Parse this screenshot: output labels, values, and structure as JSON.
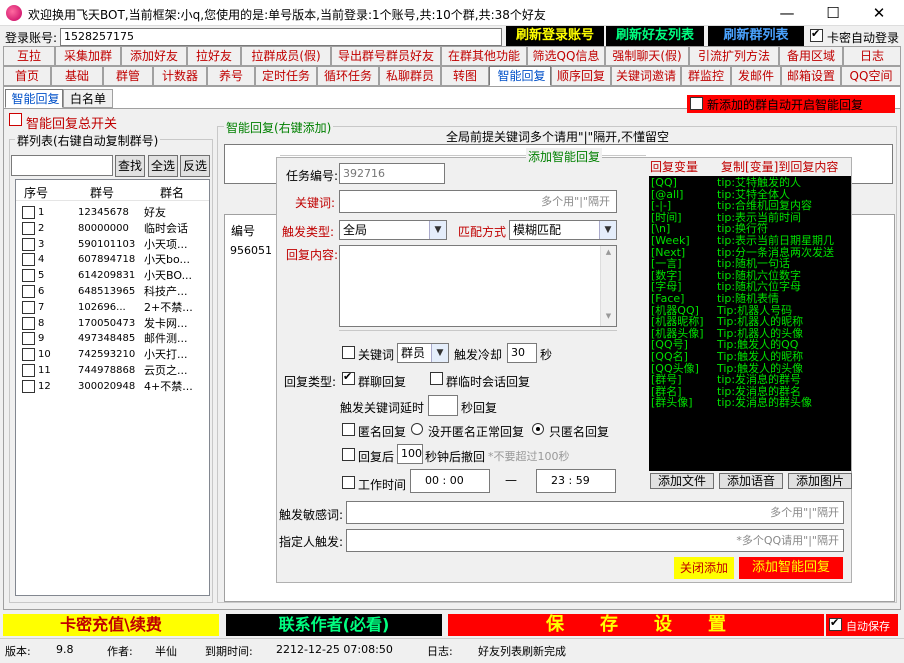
{
  "window": {
    "title": "欢迎换用飞天BOT,当前框架:小q,您使用的是:单号版本,当前登录:1个账号,共:10个群,共:38个好友",
    "minimize": "—",
    "maximize": "☐",
    "close": "✕"
  },
  "topbar": {
    "login_label": "登录账号:",
    "login_value": "1528257175",
    "refresh_login": "刷新登录账号",
    "refresh_friends": "刷新好友列表",
    "refresh_groups": "刷新群列表",
    "auto_login": "卡密自动登录",
    "auto_login_checked": true,
    "colors": {
      "refresh_login": "#ffff00",
      "refresh_friends": "#00ff80",
      "refresh_groups": "#4aa3ff"
    }
  },
  "tabs_row1": [
    "互拉",
    "采集加群",
    "添加好友",
    "拉好友",
    "拉群成员(假)",
    "导出群号群员好友",
    "在群其他功能",
    "筛选QQ信息",
    "强制聊天(假)",
    "引流扩列方法",
    "备用区域",
    "日志"
  ],
  "tabs_row2": [
    "首页",
    "基础",
    "群管",
    "计数器",
    "养号",
    "定时任务",
    "循环任务",
    "私聊群员",
    "转图",
    "智能回复",
    "顺序回复",
    "关键词邀请",
    "群监控",
    "发邮件",
    "邮箱设置",
    "QQ空间"
  ],
  "tabs_row2_selected": "智能回复",
  "subtabs": [
    "智能回复",
    "白名单"
  ],
  "subtab_selected": "智能回复",
  "new_group_auto": "新添加的群自动开启智能回复",
  "left": {
    "master_switch": "智能回复总开关",
    "group_list_title": "群列表(右键自动复制群号)",
    "search_btn": "查找",
    "select_all_btn": "全选",
    "invert_btn": "反选",
    "columns": [
      "序号",
      "群号",
      "群名"
    ],
    "rows": [
      [
        "1",
        "12345678",
        "好友"
      ],
      [
        "2",
        "80000000",
        "临时会话"
      ],
      [
        "3",
        "590101103",
        "小天项..."
      ],
      [
        "4",
        "607894718",
        "小天bo..."
      ],
      [
        "5",
        "614209831",
        "小天BO..."
      ],
      [
        "6",
        "648513965",
        "科技产..."
      ],
      [
        "7",
        "102696...",
        "2+不禁..."
      ],
      [
        "8",
        "170050473",
        "发卡网..."
      ],
      [
        "9",
        "497348485",
        "邮件测..."
      ],
      [
        "10",
        "742593210",
        "小天打..."
      ],
      [
        "11",
        "744978868",
        "云页之..."
      ],
      [
        "12",
        "300020948",
        "4+不禁..."
      ]
    ]
  },
  "right": {
    "section_title": "智能回复(右键添加)",
    "global_hint": "全局前提关键词多个请用\"|\"隔开,不懂留空",
    "col_id": "编号",
    "first_id": "956051"
  },
  "dialog": {
    "title": "添加智能回复",
    "task_label": "任务编号:",
    "task_value": "392716",
    "keyword_label": "关键词:",
    "keyword_placeholder": "多个用\"|\"隔开",
    "trigger_type_label": "触发类型:",
    "trigger_type_value": "全局",
    "match_label": "匹配方式",
    "match_value": "模糊匹配",
    "reply_label": "回复内容:",
    "kw_cb": "关键词",
    "kw_role": "群员",
    "cooldown_label": "触发冷却",
    "cooldown_value": "30",
    "cooldown_unit": "秒",
    "reply_type_label": "回复类型:",
    "group_reply": "群聊回复",
    "group_reply_checked": true,
    "temp_reply": "群临时会话回复",
    "delay_label": "触发关键词延时",
    "delay_unit": "秒回复",
    "anon_reply": "匿名回复",
    "anon_opt1": "没开匿名正常回复",
    "anon_opt2": "只匿名回复",
    "recall_label": "回复后",
    "recall_value": "100",
    "recall_unit": "秒钟后撤回",
    "recall_hint": "*不要超过100秒",
    "worktime_label": "工作时间",
    "start_h": "00",
    "start_m": "00",
    "dash": "—",
    "end_h": "23",
    "end_m": "59",
    "sensitive_label": "触发敏感词:",
    "sensitive_placeholder": "多个用\"|\"隔开",
    "specific_label": "指定人触发:",
    "specific_placeholder": "*多个QQ请用\"|\"隔开",
    "close_btn": "关闭添加",
    "add_btn": "添加智能回复"
  },
  "vars": {
    "header_left": "回复变量",
    "header_right": "复制[变量]到回复内容",
    "items": [
      [
        "[QQ]",
        "tip:艾特触发的人"
      ],
      [
        "[@all]",
        "tip:艾特全体人"
      ],
      [
        "[-|-]",
        "tip:合维机回复内容"
      ],
      [
        "[时间]",
        "tip:表示当前时间"
      ],
      [
        "[\\n]",
        "tip:换行符"
      ],
      [
        "[Week]",
        "tip:表示当前日期星期几"
      ],
      [
        "[Next]",
        "tip:分一条消息两次发送"
      ],
      [
        "[一言]",
        "tip:随机一句话"
      ],
      [
        "[数字]",
        "tip:随机六位数字"
      ],
      [
        "[字母]",
        "tip:随机六位字母"
      ],
      [
        "[Face]",
        "tip:随机表情"
      ],
      [
        "[机器QQ]",
        "Tip:机器人号码"
      ],
      [
        "[机器昵称]",
        "Tip:机器人的昵称"
      ],
      [
        "[机器头像]",
        "Tip:机器人的头像"
      ],
      [
        "[QQ号]",
        "Tip:触发人的QQ"
      ],
      [
        "[QQ名]",
        "Tip:触发人的昵称"
      ],
      [
        "[QQ头像]",
        "Tip:触发人的头像"
      ],
      [
        "[群号]",
        "tip:发消息的群号"
      ],
      [
        "[群名]",
        "tip:发消息的群名"
      ],
      [
        "[群头像]",
        "tip:发消息的群头像"
      ]
    ],
    "add_file": "添加文件",
    "add_voice": "添加语音",
    "add_image": "添加图片"
  },
  "bottom": {
    "recharge": "卡密充值\\续费",
    "contact": "联系作者(必看)",
    "save": "保　　存　　设　　置",
    "autosave": "自动保存",
    "autosave_checked": true
  },
  "status": {
    "version_label": "版本:",
    "version": "9.8",
    "author_label": "作者:",
    "author": "半仙",
    "expire_label": "到期时间:",
    "expire": "2212-12-25 07:08:50",
    "log_label": "日志:",
    "log": "好友列表刷新完成"
  }
}
